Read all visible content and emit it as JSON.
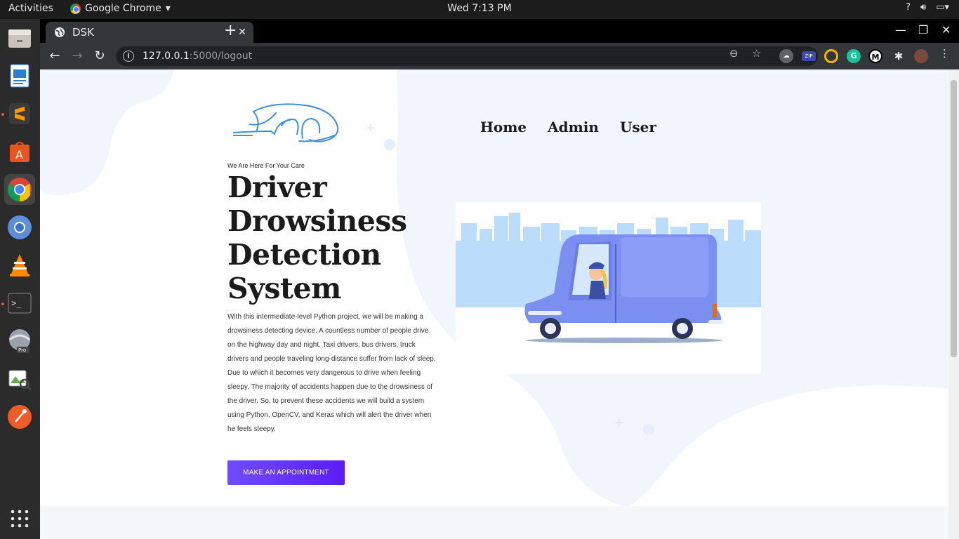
{
  "desktop": {
    "activities": "Activities",
    "app_name": "Google Chrome",
    "clock": "Wed  7:13 PM",
    "dock_apps": [
      "files-icon",
      "writer-icon",
      "sublime-icon",
      "software-center-icon",
      "chrome-icon",
      "chromium-icon",
      "vlc-icon",
      "terminal-icon",
      "google-earth-icon",
      "image-viewer-icon",
      "postman-icon",
      "app-grid-icon"
    ]
  },
  "browser": {
    "tab_title": "DSK",
    "url_host": "127.0.0.1",
    "url_path": ":5000/logout",
    "extensions": [
      "cloud-icon",
      "zip-icon",
      "ring-icon",
      "grammarly-icon",
      "m-icon",
      "puzzle-icon",
      "profile-avatar"
    ]
  },
  "page": {
    "nav": {
      "home": "Home",
      "admin": "Admin",
      "user": "User"
    },
    "kicker": "We Are Here For Your Care",
    "title": "Driver Drowsiness Detection System",
    "description": "With this intermediate-level Python project, we will be making a drowsiness detecting device. A countless number of people drive on the highway day and night. Taxi drivers, bus drivers, truck drivers and people traveling long-distance suffer from lack of sleep. Due to which it becomes very dangerous to drive when feeling sleepy. The majority of accidents happen due to the drowsiness of the driver. So, to prevent these accidents we will build a system using Python, OpenCV, and Keras which will alert the driver when he feels sleepy.",
    "cta": "MAKE AN APPOINTMENT",
    "colors": {
      "accent_start": "#6f4cff",
      "accent_end": "#5a1cf6",
      "blob": "#f1f6fd",
      "van": "#7b8ff0",
      "city": "#bcdcfb"
    }
  }
}
